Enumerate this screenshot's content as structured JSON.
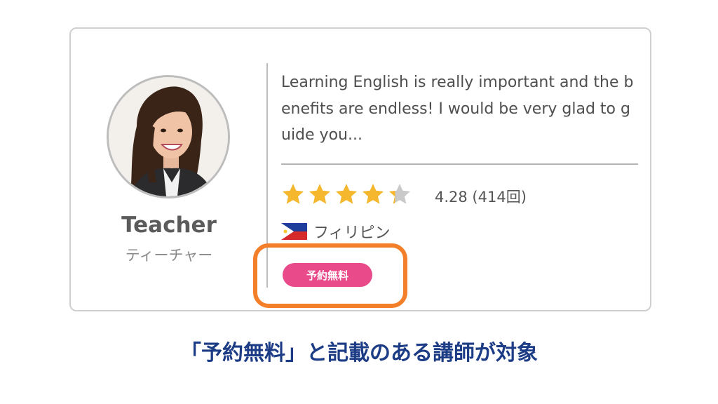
{
  "teacher": {
    "name": "Teacher",
    "name_kana": "ティーチャー",
    "intro_lines": [
      "Learning English is really important and the b",
      "enefits are endless! I would be very glad to g",
      "uide you..."
    ],
    "rating": 4.28,
    "rating_text": "4.28 (414回)",
    "country": "フィリピン",
    "badge": "予約無料"
  },
  "colors": {
    "star_filled": "#f5b72e",
    "star_empty": "#c9c9c9",
    "badge": "#e84a8a",
    "highlight": "#f47f2a",
    "caption": "#1d3c86"
  },
  "caption": "「予約無料」と記載のある講師が対象"
}
